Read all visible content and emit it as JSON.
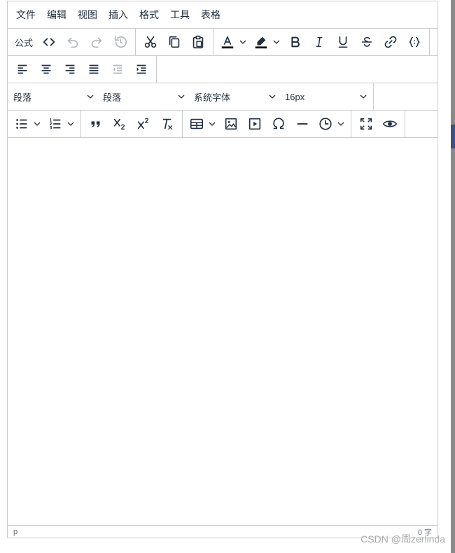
{
  "menubar": {
    "items": [
      {
        "label": "文件"
      },
      {
        "label": "编辑"
      },
      {
        "label": "视图"
      },
      {
        "label": "插入"
      },
      {
        "label": "格式"
      },
      {
        "label": "工具"
      },
      {
        "label": "表格"
      }
    ]
  },
  "toolbar": {
    "formula_label": "公式",
    "block_format": "段落",
    "paragraph_style": "段落",
    "font_family": "系统字体",
    "font_size": "16px"
  },
  "statusbar": {
    "path": "p",
    "word_count": "0 字"
  },
  "watermark": "CSDN @周zerlinda",
  "colors": {
    "border": "#cccccc",
    "icon": "#222f3e",
    "text_color_bar": "#000000",
    "side_tab": "#34558b",
    "right_strip": "#8a8a8a"
  }
}
